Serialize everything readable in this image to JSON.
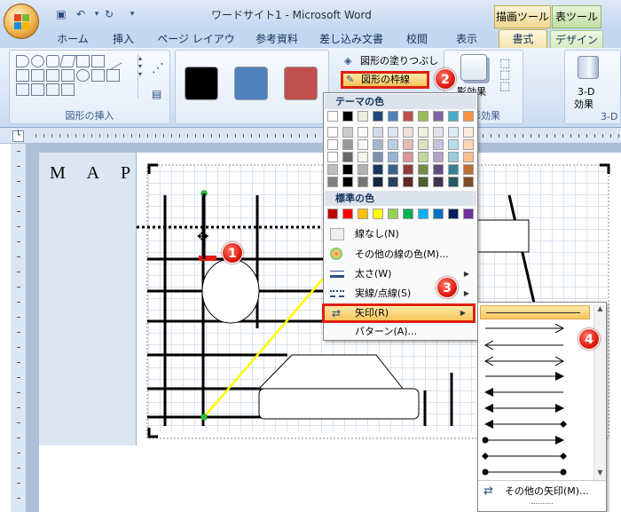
{
  "window": {
    "title": "ワードサイト1 - Microsoft Word",
    "ctx_drawing": "描画ツール",
    "ctx_table": "表ツール"
  },
  "tabs": [
    "ホーム",
    "挿入",
    "ページ レイアウト",
    "参考資料",
    "差し込み文書",
    "校閲",
    "表示",
    "書式",
    "デザイン"
  ],
  "ribbon": {
    "group_insert_shapes": "図形の挿入",
    "fill_label": "図形の塗りつぶし",
    "outline_label": "図形の枠線",
    "shadow_label": "影効果",
    "shadow_group": "影効果",
    "three_d_label": "3-D",
    "three_d_label2": "効果",
    "three_d_group": "3-D",
    "style_colors": [
      "#000000",
      "#4f81bd",
      "#c0504d"
    ]
  },
  "document": {
    "heading": "M A P"
  },
  "dropdown": {
    "theme_colors_header": "テーマの色",
    "standard_colors_header": "標準の色",
    "no_line": "線なし(N)",
    "more_colors": "その他の線の色(M)...",
    "weight": "太さ(W)",
    "dashes": "実線/点線(S)",
    "arrows": "矢印(R)",
    "pattern": "パターン(A)...",
    "theme_top": [
      "#ffffff",
      "#000000",
      "#eeece1",
      "#1f497d",
      "#4f81bd",
      "#c0504d",
      "#9bbb59",
      "#8064a2",
      "#4bacc6",
      "#f79646"
    ],
    "standard": [
      "#c00000",
      "#ff0000",
      "#ffc000",
      "#ffff00",
      "#92d050",
      "#00b050",
      "#00b0f0",
      "#0070c0",
      "#002060",
      "#7030a0"
    ]
  },
  "arrow_menu": {
    "more_arrows": "その他の矢印(M)..."
  },
  "badges": [
    "1",
    "2",
    "3",
    "4"
  ]
}
